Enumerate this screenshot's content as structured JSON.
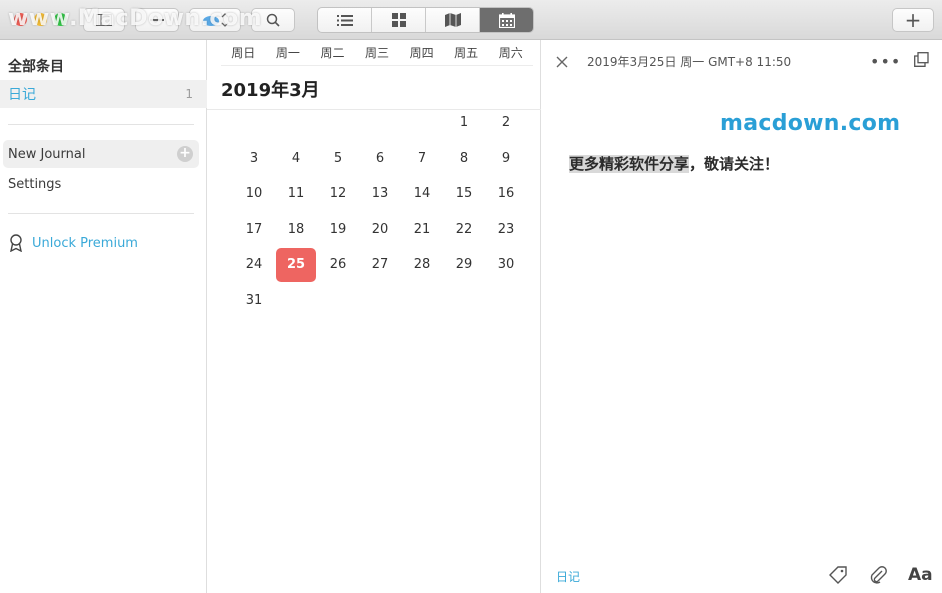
{
  "toolbar": {
    "watermark": "www.MacDown.com",
    "views": [
      {
        "name": "list-view",
        "active": false
      },
      {
        "name": "grid-view",
        "active": false
      },
      {
        "name": "map-view",
        "active": false
      },
      {
        "name": "calendar-view",
        "active": true
      }
    ],
    "add_label": "+"
  },
  "sidebar": {
    "header": "全部条目",
    "diary": {
      "label": "日记",
      "count": "1"
    },
    "new_journal": "New Journal",
    "settings": "Settings",
    "unlock": "Unlock Premium"
  },
  "calendar": {
    "weekdays": [
      "周日",
      "周一",
      "周二",
      "周三",
      "周四",
      "周五",
      "周六"
    ],
    "month_title": "2019年3月",
    "selected_day": "25",
    "days": [
      "",
      "",
      "",
      "",
      "",
      "1",
      "2",
      "3",
      "4",
      "5",
      "6",
      "7",
      "8",
      "9",
      "10",
      "11",
      "12",
      "13",
      "14",
      "15",
      "16",
      "17",
      "18",
      "19",
      "20",
      "21",
      "22",
      "23",
      "24",
      "25",
      "26",
      "27",
      "28",
      "29",
      "30",
      "31"
    ]
  },
  "entry": {
    "date": "2019年3月25日 周一 GMT+8 11:50",
    "watermark": "macdown.com",
    "text_highlight": "更多精彩软件分享",
    "text_rest": "，敬请关注！",
    "journal": "日记",
    "font_label": "Aa"
  },
  "colors": {
    "accent": "#3aa9d8",
    "selected_day": "#ee6561"
  }
}
